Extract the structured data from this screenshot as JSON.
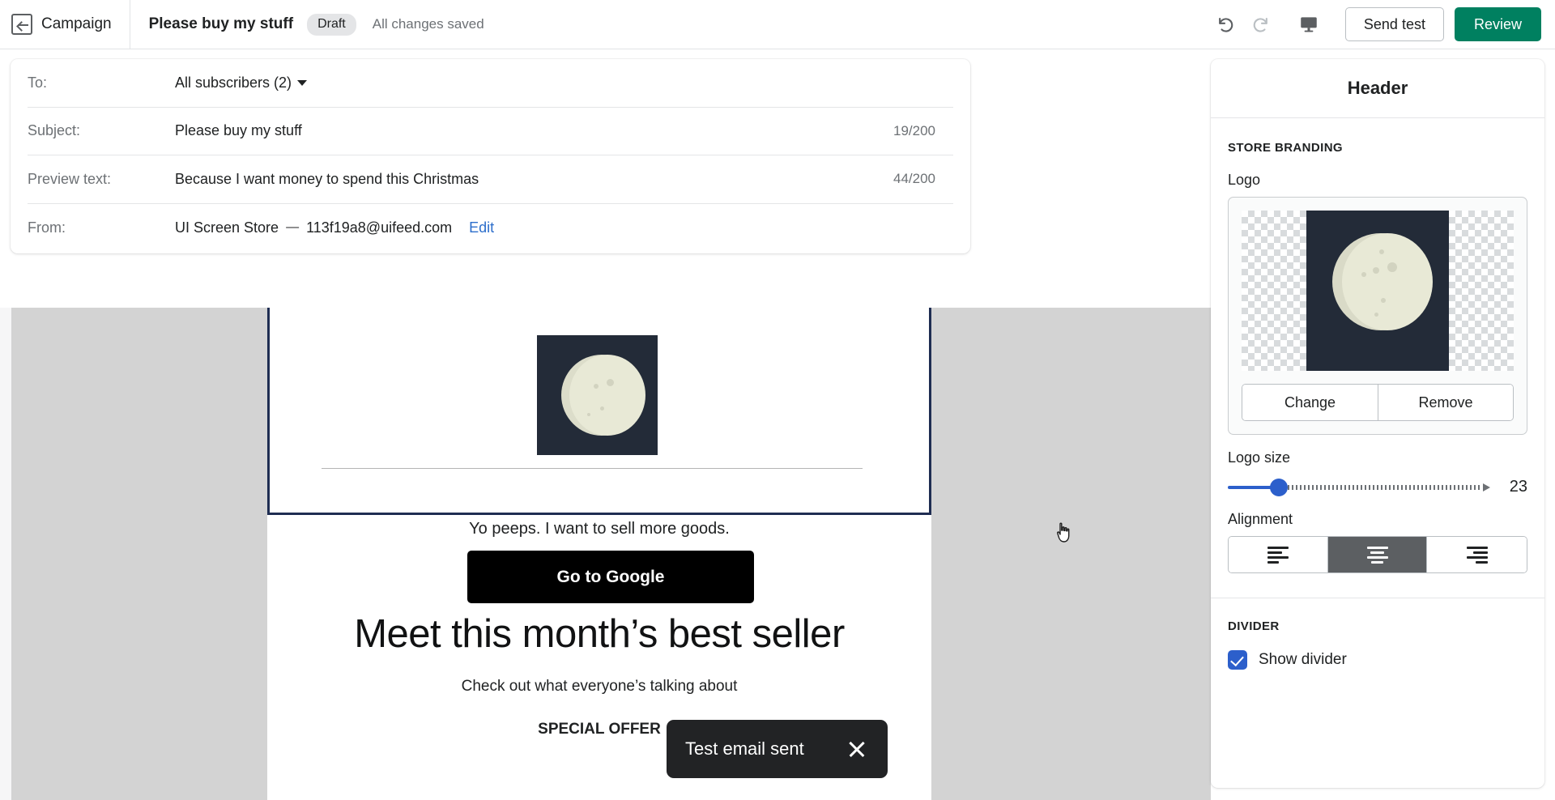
{
  "topbar": {
    "back_label": "Campaign",
    "back_icon": "arrow-left-boxed-icon",
    "doc_title": "Please buy my stuff",
    "status_badge": "Draft",
    "save_status": "All changes saved",
    "undo_icon": "undo-icon",
    "redo_icon": "redo-icon",
    "desktop_preview_icon": "desktop-monitor-icon",
    "send_test_label": "Send test",
    "review_label": "Review",
    "review_color": "#008060"
  },
  "settings": {
    "rows": [
      {
        "label": "To:",
        "value": "All subscribers (2)",
        "counter": "",
        "dropdown": true
      },
      {
        "label": "Subject:",
        "value": "Please buy my stuff",
        "counter": "19/200",
        "dropdown": false
      },
      {
        "label": "Preview text:",
        "value": "Because I want money to spend this Christmas",
        "counter": "44/200",
        "dropdown": false
      }
    ],
    "from": {
      "label": "From:",
      "store_name": "UI Screen Store",
      "separator": "—",
      "email": "113f19a8@uifeed.com",
      "edit_label": "Edit",
      "edit_color": "#2c6ecb"
    }
  },
  "email_preview": {
    "selected_block": "header",
    "selection_color": "#1f2d52",
    "logo_alt": "moon-logo",
    "tagline": "Yo peeps. I want to sell more goods.",
    "cta_label": "Go to Google",
    "heading": "Meet this month’s best seller",
    "subtext": "Check out what everyone’s talking about",
    "offer_label": "SPECIAL OFFER"
  },
  "toast": {
    "message": "Test email sent",
    "close_icon": "close-icon"
  },
  "panel": {
    "title": "Header",
    "store_branding_label": "STORE BRANDING",
    "logo_label": "Logo",
    "logo_alt": "moon-logo",
    "change_label": "Change",
    "remove_label": "Remove",
    "logo_size_label": "Logo size",
    "logo_size_value": "23",
    "slider_color": "#2c5fcb",
    "alignment_label": "Alignment",
    "alignment_options": [
      {
        "name": "align-left",
        "icon": "align-left-icon",
        "selected": false
      },
      {
        "name": "align-center",
        "icon": "align-center-icon",
        "selected": true
      },
      {
        "name": "align-right",
        "icon": "align-right-icon",
        "selected": false
      }
    ],
    "divider_section_label": "DIVIDER",
    "show_divider_label": "Show divider",
    "show_divider_checked": true
  }
}
